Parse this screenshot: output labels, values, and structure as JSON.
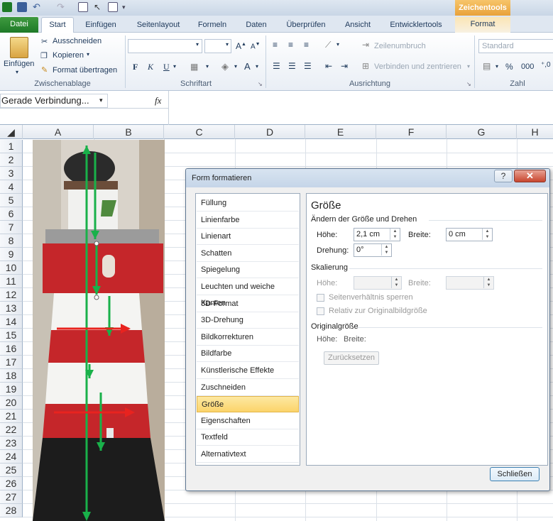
{
  "title_bar": {
    "context_tab": "Zeichentools"
  },
  "tabs": [
    "Datei",
    "Start",
    "Einfügen",
    "Seitenlayout",
    "Formeln",
    "Daten",
    "Überprüfen",
    "Ansicht",
    "Entwicklertools",
    "Format"
  ],
  "ribbon": {
    "clipboard": {
      "paste": "Einfügen",
      "cut": "Ausschneiden",
      "copy": "Kopieren",
      "format_painter": "Format übertragen",
      "group": "Zwischenablage"
    },
    "font": {
      "bold": "F",
      "italic": "K",
      "underline": "U",
      "group": "Schriftart"
    },
    "alignment": {
      "wrap": "Zeilenumbruch",
      "merge": "Verbinden und zentrieren",
      "group": "Ausrichtung"
    },
    "number": {
      "format": "Standard",
      "percent": "%",
      "thousands": "000",
      "group": "Zahl"
    }
  },
  "formula_bar": {
    "name_box": "Gerade Verbindung...",
    "fx": "fx"
  },
  "columns": [
    "A",
    "B",
    "C",
    "D",
    "E",
    "F",
    "G",
    "H"
  ],
  "rows": [
    "1",
    "2",
    "3",
    "4",
    "5",
    "6",
    "7",
    "8",
    "9",
    "10",
    "11",
    "12",
    "13",
    "14",
    "15",
    "16",
    "17",
    "18",
    "19",
    "20",
    "21",
    "22",
    "23",
    "24",
    "25",
    "26",
    "27",
    "28"
  ],
  "dialog": {
    "title": "Form formatieren",
    "help": "?",
    "close": "✕",
    "categories": [
      "Füllung",
      "Linienfarbe",
      "Linienart",
      "Schatten",
      "Spiegelung",
      "Leuchten und weiche Kanten",
      "3D-Format",
      "3D-Drehung",
      "Bildkorrekturen",
      "Bildfarbe",
      "Künstlerische Effekte",
      "Zuschneiden",
      "Größe",
      "Eigenschaften",
      "Textfeld",
      "Alternativtext"
    ],
    "selected_category": "Größe",
    "panel": {
      "heading": "Größe",
      "section_resize": "Ändern der Größe und Drehen",
      "height_label": "Höhe:",
      "height_value": "2,1 cm",
      "width_label": "Breite:",
      "width_value": "0 cm",
      "rotation_label": "Drehung:",
      "rotation_value": "0°",
      "section_scale": "Skalierung",
      "scale_height_label": "Höhe:",
      "scale_width_label": "Breite:",
      "lock_aspect": "Seitenverhältnis sperren",
      "relative_original": "Relativ zur Originalbildgröße",
      "section_original": "Originalgröße",
      "orig_height_label": "Höhe:",
      "orig_width_label": "Breite:",
      "reset": "Zurücksetzen"
    },
    "close_button": "Schließen"
  }
}
